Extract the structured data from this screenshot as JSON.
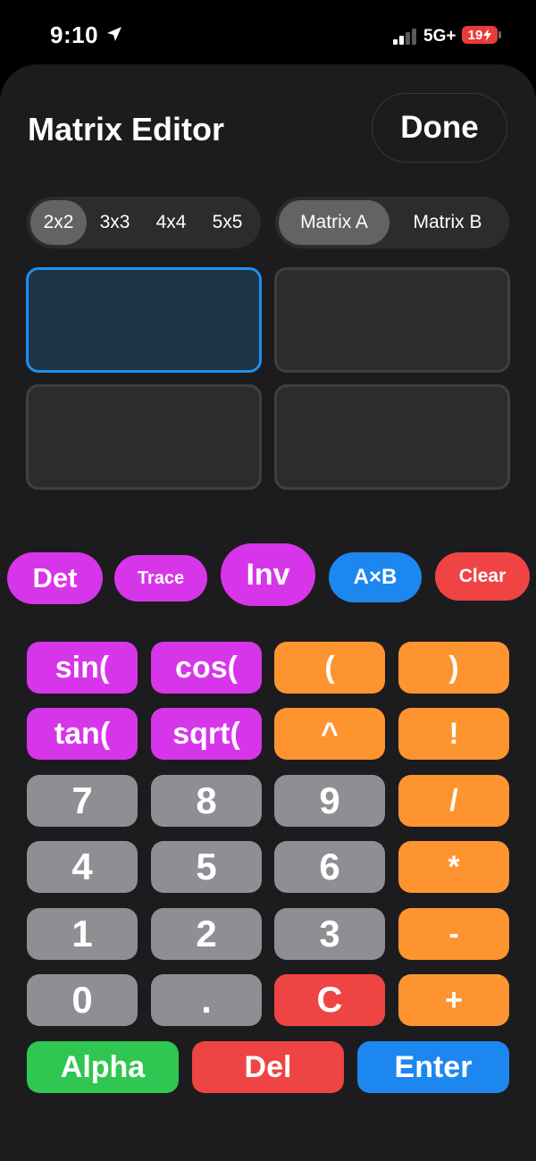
{
  "status_bar": {
    "time": "9:10",
    "network": "5G+",
    "battery": "19"
  },
  "header": {
    "title": "Matrix Editor",
    "done_label": "Done"
  },
  "size_selector": {
    "options": [
      "2x2",
      "3x3",
      "4x4",
      "5x5"
    ],
    "selected": "2x2"
  },
  "matrix_selector": {
    "options": [
      "Matrix A",
      "Matrix B"
    ],
    "selected": "Matrix A"
  },
  "matrix": {
    "rows": 2,
    "cols": 2,
    "cells": [
      [
        "",
        ""
      ],
      [
        "",
        ""
      ]
    ],
    "focused_cell": [
      0,
      0
    ]
  },
  "functions": {
    "det": "Det",
    "trace": "Trace",
    "inv": "Inv",
    "axb": "A×B",
    "clear": "Clear"
  },
  "keypad": {
    "row1": [
      "sin(",
      "cos(",
      "(",
      ")"
    ],
    "row2": [
      "tan(",
      "sqrt(",
      "^",
      "!"
    ],
    "row3": [
      "7",
      "8",
      "9",
      "/"
    ],
    "row4": [
      "4",
      "5",
      "6",
      "*"
    ],
    "row5": [
      "1",
      "2",
      "3",
      "-"
    ],
    "row6": [
      "0",
      ".",
      "C",
      "+"
    ],
    "bottom": [
      "Alpha",
      "Del",
      "Enter"
    ]
  },
  "colors": {
    "function_purple": "#d735e9",
    "operator_orange": "#fd9430",
    "digit_gray": "#8e8e93",
    "accent_blue": "#1d87f0",
    "danger_red": "#ef4444",
    "alpha_green": "#2fc651"
  }
}
